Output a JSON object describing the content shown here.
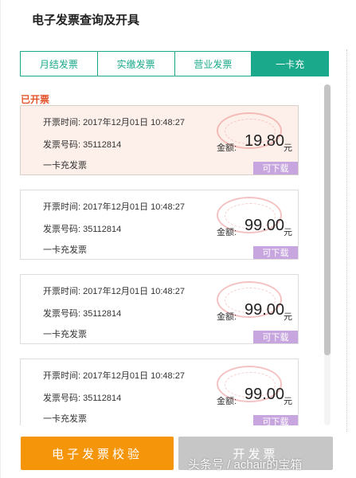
{
  "page": {
    "title": "电子发票查询及开具"
  },
  "tabs": [
    {
      "label": "月结发票",
      "active": false
    },
    {
      "label": "实缴发票",
      "active": false
    },
    {
      "label": "营业发票",
      "active": false
    },
    {
      "label": "一卡充",
      "active": true
    }
  ],
  "section": {
    "label": "已开票"
  },
  "invoices": [
    {
      "time_label": "开票时间:",
      "time": "2017年12月01日 10:48:27",
      "number_label": "发票号码:",
      "number": "35112814",
      "type": "一卡充发票",
      "amount_label": "金额:",
      "amount": "19.80",
      "amount_unit": "元",
      "download_label": "可下载"
    },
    {
      "time_label": "开票时间:",
      "time": "2017年12月01日 10:48:27",
      "number_label": "发票号码:",
      "number": "35112814",
      "type": "一卡充发票",
      "amount_label": "金额:",
      "amount": "99.00",
      "amount_unit": "元",
      "download_label": "可下载"
    },
    {
      "time_label": "开票时间:",
      "time": "2017年12月01日 10:48:27",
      "number_label": "发票号码:",
      "number": "35112814",
      "type": "一卡充发票",
      "amount_label": "金额:",
      "amount": "99.00",
      "amount_unit": "元",
      "download_label": "可下载"
    },
    {
      "time_label": "开票时间:",
      "time": "2017年12月01日 10:48:27",
      "number_label": "发票号码:",
      "number": "35112814",
      "type": "一卡充发票",
      "amount_label": "金额:",
      "amount": "99.00",
      "amount_unit": "元",
      "download_label": "可下载"
    }
  ],
  "buttons": {
    "verify": "电子发票校验",
    "issue": "开发票"
  },
  "watermark": "头条号 / achair的宝箱",
  "colors": {
    "accent": "#1aa98a",
    "verify_button": "#f5950a",
    "issue_button": "#c6c6c6",
    "download_badge": "#c7a6df",
    "section_label": "#e4572e"
  }
}
